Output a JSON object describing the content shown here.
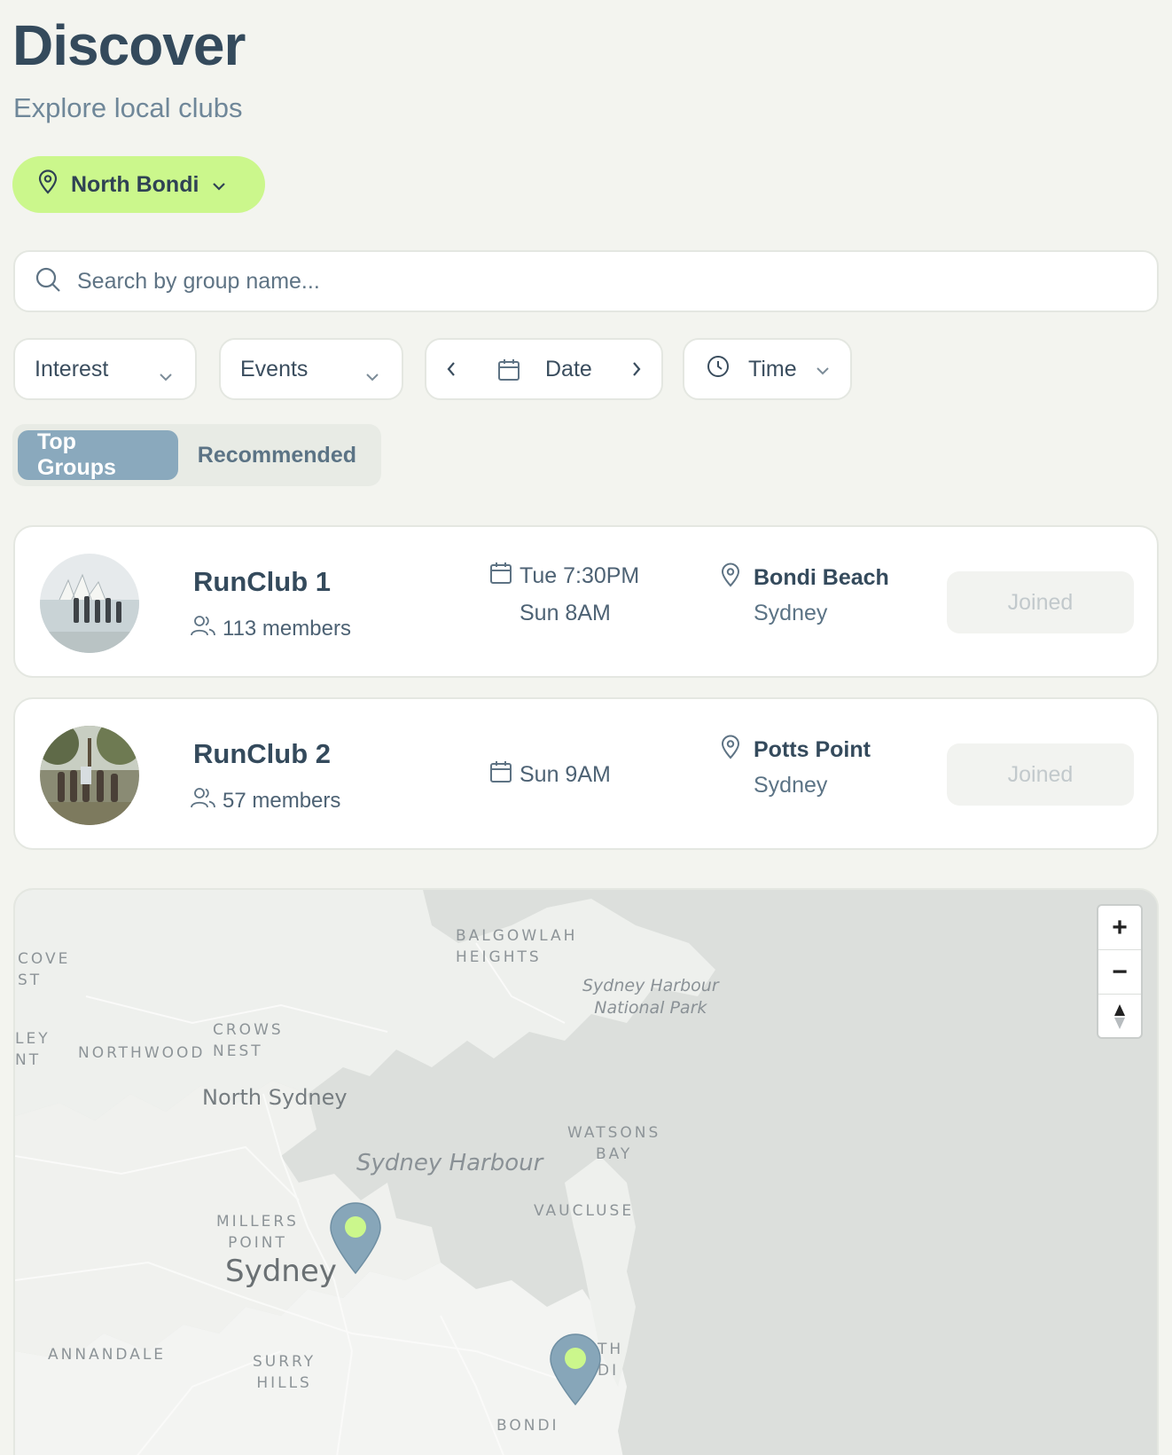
{
  "header": {
    "title": "Discover",
    "subtitle": "Explore local clubs"
  },
  "location": {
    "label": "North Bondi",
    "icon": "map-pin-icon"
  },
  "search": {
    "placeholder": "Search by group name..."
  },
  "filters": {
    "interest": "Interest",
    "events": "Events",
    "date": "Date",
    "time": "Time"
  },
  "tabs": [
    {
      "label": "Top Groups",
      "active": true
    },
    {
      "label": "Recommended",
      "active": false
    }
  ],
  "clubs": [
    {
      "name": "RunClub 1",
      "members": "113 members",
      "times": [
        "Tue 7:30PM",
        "Sun 8AM"
      ],
      "place": "Bondi Beach",
      "city": "Sydney",
      "action": "Joined"
    },
    {
      "name": "RunClub 2",
      "members": "57 members",
      "times": [
        "Sun 9AM"
      ],
      "place": "Potts Point",
      "city": "Sydney",
      "action": "Joined"
    }
  ],
  "map": {
    "labels": {
      "balgowlah": "BALGOWLAH\nHEIGHTS",
      "cove": "COVE\nST",
      "ley": "LEY\nNT",
      "northwood": "NORTHWOOD",
      "crows_nest": "CROWS\nNEST",
      "north_sydney": "North Sydney",
      "harbour_np": "Sydney Harbour\nNational Park",
      "watsons_bay": "WATSONS\nBAY",
      "sydney_harbour": "Sydney Harbour",
      "vaucluse": "VAUCLUSE",
      "millers_point": "MILLERS\nPOINT",
      "sydney": "Sydney",
      "annandale": "ANNANDALE",
      "surry_hills": "SURRY\nHILLS",
      "bondi": "BONDI",
      "north_bondi": "TH\nDI"
    },
    "zoom_in": "+",
    "zoom_out": "−",
    "compass": "compass-icon"
  },
  "colors": {
    "accent": "#cbf78c",
    "tab_active": "#8aa9bd",
    "marker": "#87a6b9",
    "text": "#344a5c"
  }
}
